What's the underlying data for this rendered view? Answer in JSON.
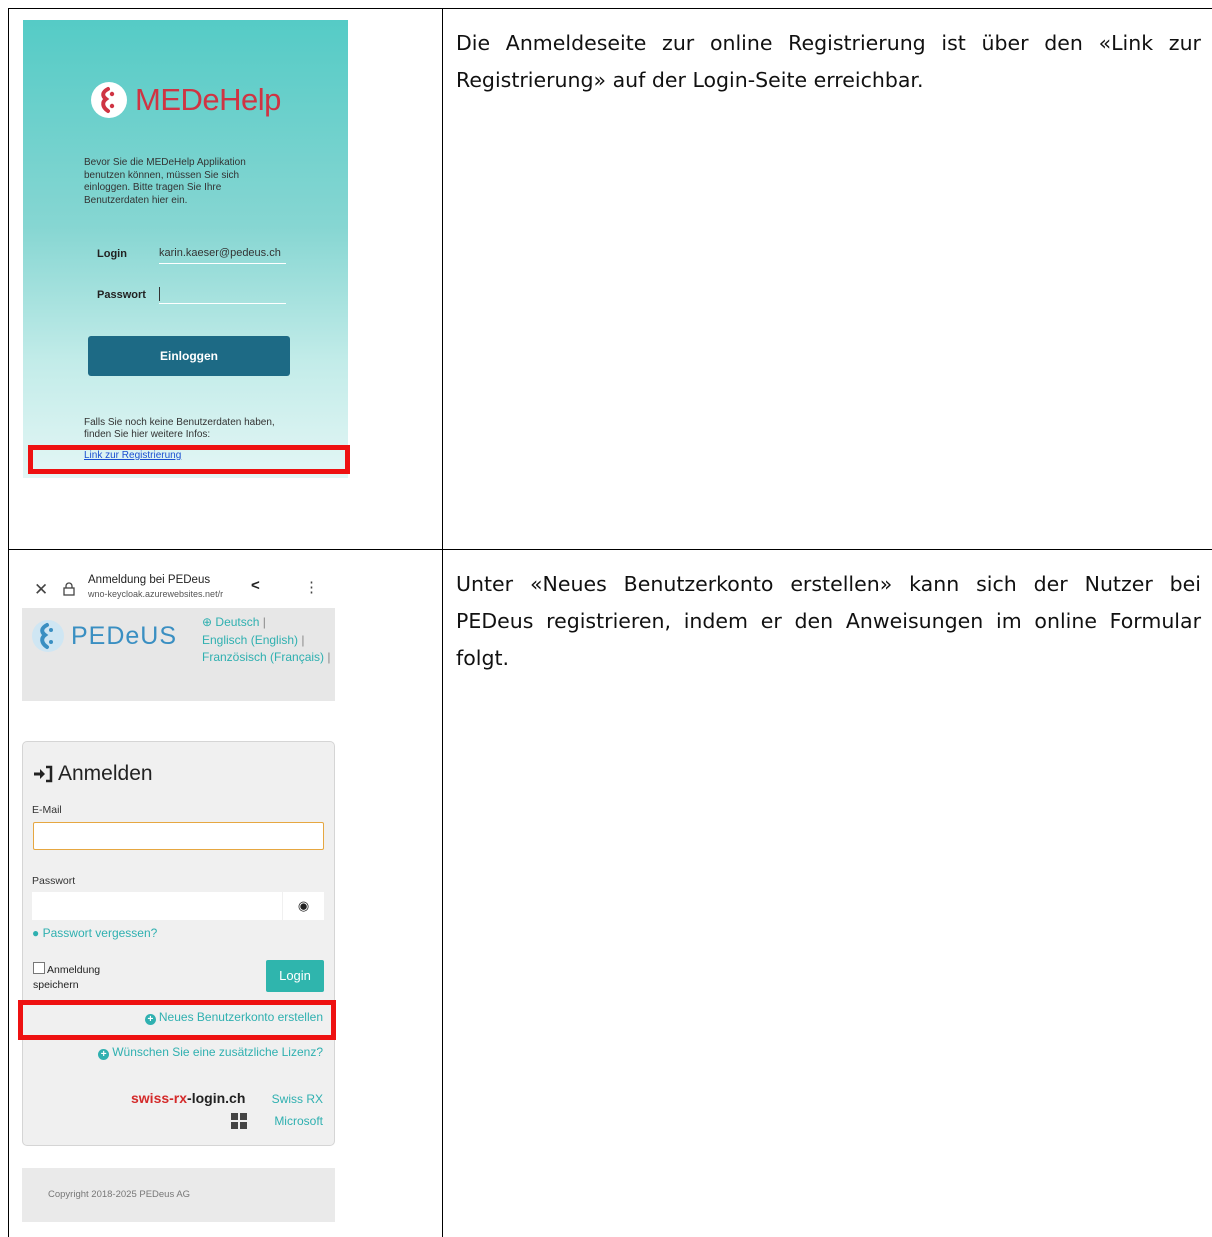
{
  "rows": [
    {
      "description": "Die Anmeldeseite zur online Registrierung ist über den «Link zur Registrierung» auf der Login-Seite erreichbar.",
      "screenshot": {
        "brand": "MEDeHelp",
        "intro": "Bevor Sie die MEDeHelp Applikation benutzen können, müssen Sie sich einloggen. Bitte tragen Sie Ihre Benutzerdaten hier ein.",
        "login_label": "Login",
        "login_value": "karin.kaeser@pedeus.ch",
        "password_label": "Passwort",
        "submit_label": "Einloggen",
        "footer_text": "Falls Sie noch keine Benutzerdaten haben, finden Sie hier weitere Infos:",
        "register_link": "Link zur Registrierung",
        "colors": {
          "brand_red": "#cf3443",
          "button": "#1d6a85",
          "highlight": "#ee1111"
        }
      }
    },
    {
      "description": "Unter «Neues Benutzerkonto erstellen» kann sich der Nutzer bei PEDeus registrieren, indem er den Anweisungen im online Formular folgt.",
      "screenshot": {
        "browser_title": "Anmeldung bei PEDeus",
        "browser_url": "wno-keycloak.azurewebsites.net/r",
        "brand": "PEDeUS",
        "languages": [
          "Deutsch",
          "Englisch (English)",
          "Französisch (Français)"
        ],
        "heading": "Anmelden",
        "email_label": "E-Mail",
        "password_label": "Passwort",
        "forgot_password": "Passwort vergessen?",
        "remember_label": "Anmeldung speichern",
        "login_button": "Login",
        "new_account": "Neues Benutzerkonto erstellen",
        "extra_license": "Wünschen Sie eine zusätzliche Lizenz?",
        "swiss_rx_part1": "swiss-rx",
        "swiss_rx_part2": "-login.ch",
        "swiss_rx_link": "Swiss RX",
        "microsoft_link": "Microsoft",
        "copyright": "Copyright 2018-2025 PEDeus AG",
        "colors": {
          "accent": "#2fb0b0",
          "highlight": "#ee1111"
        }
      }
    }
  ]
}
